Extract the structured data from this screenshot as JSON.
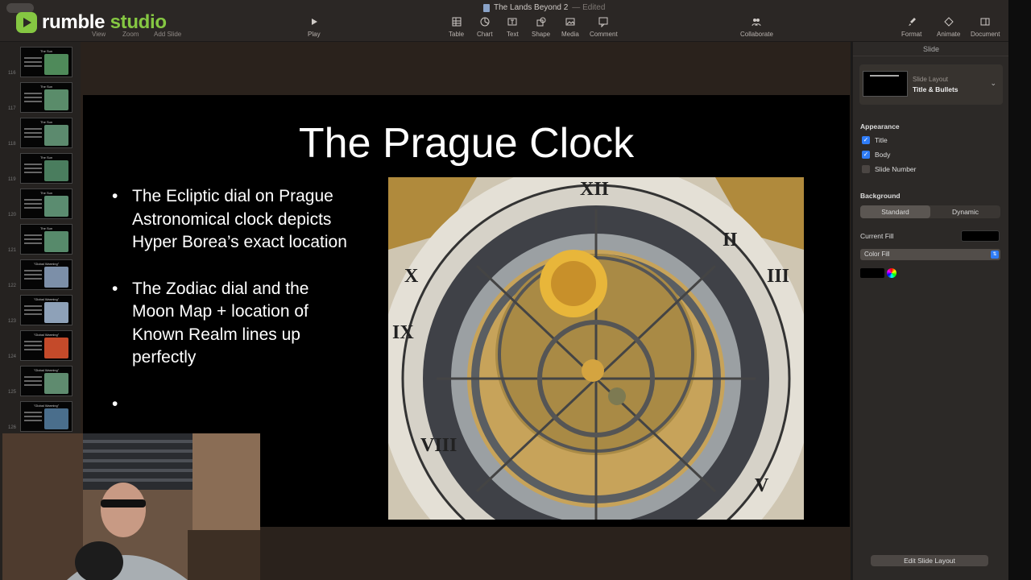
{
  "brand": {
    "part1": "rumble",
    "part2": " studio"
  },
  "document": {
    "title": "The Lands Beyond 2",
    "edited": "— Edited"
  },
  "toolbar": {
    "view": "View",
    "zoom": "Zoom",
    "add_slide": "Add Slide",
    "play": "Play",
    "table": "Table",
    "chart": "Chart",
    "text": "Text",
    "shape": "Shape",
    "media": "Media",
    "comment": "Comment",
    "collaborate": "Collaborate",
    "format": "Format",
    "animate": "Animate",
    "document": "Document"
  },
  "navigator": {
    "slides": [
      {
        "num": "116",
        "title": "The Sun"
      },
      {
        "num": "117",
        "title": "The Sun"
      },
      {
        "num": "118",
        "title": "The Sun"
      },
      {
        "num": "119",
        "title": "The Sun"
      },
      {
        "num": "120",
        "title": "The Sun"
      },
      {
        "num": "121",
        "title": "The Sun"
      },
      {
        "num": "122",
        "title": "\"Global Warming\""
      },
      {
        "num": "123",
        "title": "\"Global Warming\""
      },
      {
        "num": "124",
        "title": "\"Global Warming\""
      },
      {
        "num": "125",
        "title": "\"Global Warming\""
      },
      {
        "num": "126",
        "title": "\"Global Warming\""
      }
    ]
  },
  "slide": {
    "title": "The Prague Clock",
    "bullets": [
      "The Ecliptic dial on Prague Astronomical clock depicts Hyper Borea’s exact location",
      "The Zodiac dial and the Moon Map + location of Known Realm lines up perfectly",
      ""
    ]
  },
  "inspector": {
    "header": "Slide",
    "layout_label": "Slide Layout",
    "layout_value": "Title & Bullets",
    "appearance": "Appearance",
    "title_opt": "Title",
    "body_opt": "Body",
    "slide_number_opt": "Slide Number",
    "background": "Background",
    "standard": "Standard",
    "dynamic": "Dynamic",
    "current_fill": "Current Fill",
    "color_fill": "Color Fill",
    "edit_layout": "Edit Slide Layout"
  },
  "colors": {
    "accent": "#85c742",
    "select_blue": "#2f7cf6"
  }
}
